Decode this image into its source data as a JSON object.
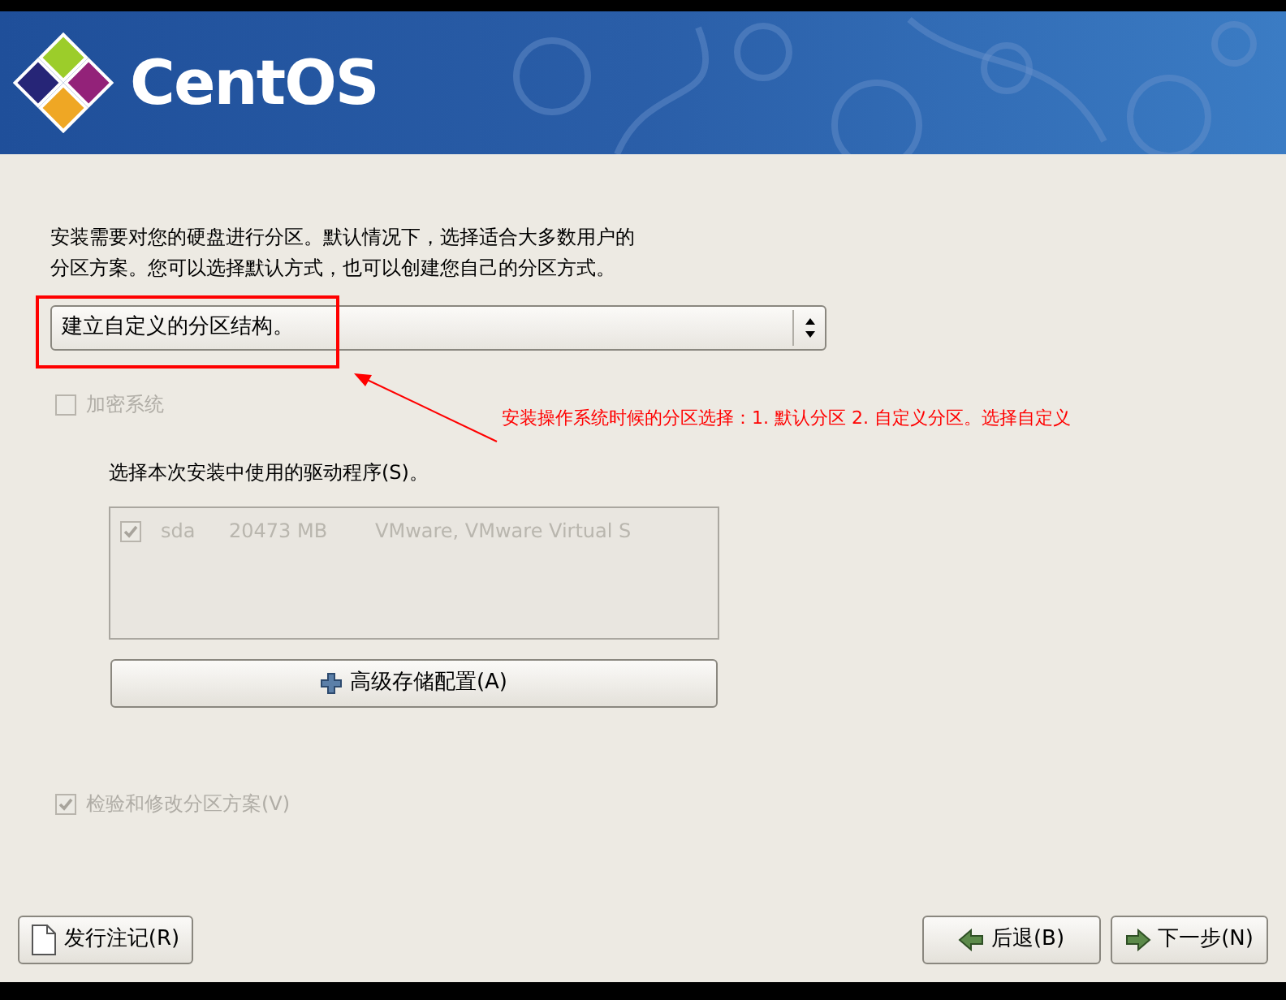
{
  "header": {
    "logo_text": "CentOS"
  },
  "intro": [
    "安装需要对您的硬盘进行分区。默认情况下，选择适合大多数用户的",
    "分区方案。您可以选择默认方式，也可以创建您自己的分区方式。"
  ],
  "partition_select": {
    "value": "建立自定义的分区结构。"
  },
  "encrypt": {
    "label": "加密系统",
    "checked": false,
    "disabled": true
  },
  "drives_label": "选择本次安装中使用的驱动程序(S)。",
  "drives": [
    {
      "checked": true,
      "name": "sda",
      "size": "20473 MB",
      "model": "VMware, VMware Virtual S"
    }
  ],
  "advanced_button": "高级存储配置(A)",
  "review": {
    "label": "检验和修改分区方案(V)",
    "checked": true,
    "disabled": true
  },
  "buttons": [
    {
      "kind": "notes",
      "label": "发行注记(R)"
    },
    {
      "kind": "back",
      "label": "后退(B)"
    },
    {
      "kind": "next",
      "label": "下一步(N)"
    }
  ],
  "annotation": {
    "text": "安装操作系统时候的分区选择：1. 默认分区 2. 自定义分区。选择自定义"
  }
}
